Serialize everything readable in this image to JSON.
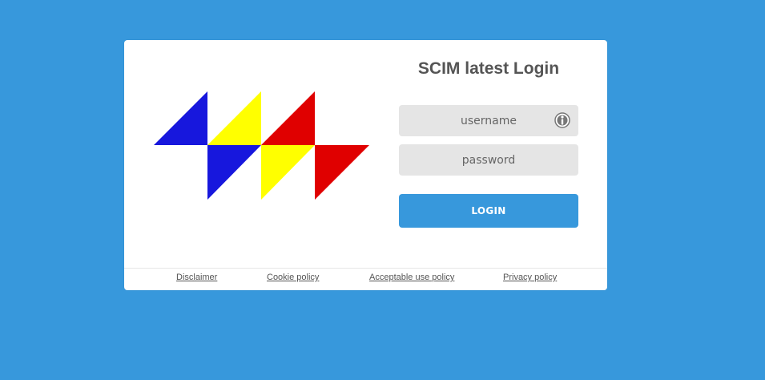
{
  "login": {
    "title": "SCIM latest Login",
    "username_placeholder": "username",
    "password_placeholder": "password",
    "username_icon": "user-info-icon",
    "button_label": "LOGIN"
  },
  "footer": {
    "links": [
      {
        "label": "Disclaimer"
      },
      {
        "label": "Cookie policy"
      },
      {
        "label": "Acceptable use policy"
      },
      {
        "label": "Privacy policy"
      }
    ]
  },
  "colors": {
    "background": "#3798dc",
    "card": "#ffffff",
    "button": "#3798dc",
    "field": "#e5e5e5",
    "logo_blue": "#1717dd",
    "logo_yellow": "#ffff00",
    "logo_red": "#e00000"
  }
}
